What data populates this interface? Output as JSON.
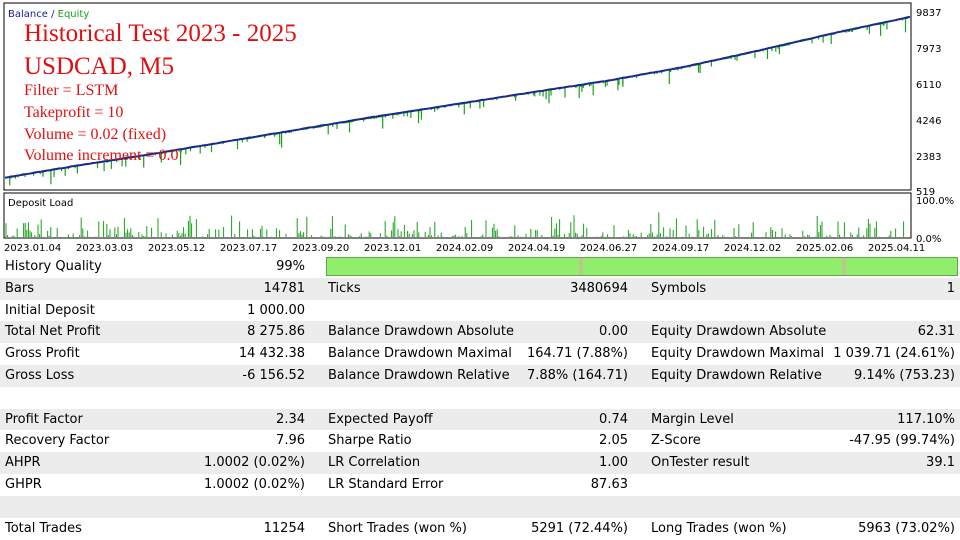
{
  "chart": {
    "legend_balance": "Balance",
    "legend_sep": " / ",
    "legend_equity": "Equity",
    "colors": {
      "balance": "#1a2a8c",
      "equity": "#1aa01a",
      "deposit_load": "#1aa01a",
      "legend_balance": "#1a1aa0",
      "legend_equity": "#1aa01a"
    },
    "overlay_title_1": "Historical Test 2023 - 2025",
    "overlay_title_2": "USDCAD, M5",
    "overlay_lines": [
      "Filter = LSTM",
      "Takeprofit = 10",
      "Volume = 0.02 (fixed)",
      "Volume increment = 0.0"
    ],
    "y_ticks": [
      "9837",
      "7973",
      "6110",
      "4246",
      "2383",
      "519"
    ],
    "deposit_load_label": "Deposit Load",
    "deposit_load_ticks": [
      "100.0%",
      "0.0%"
    ],
    "x_ticks": [
      "2023.01.04",
      "2023.03.03",
      "2023.05.12",
      "2023.07.17",
      "2023.09.20",
      "2023.12.01",
      "2024.02.09",
      "2024.04.19",
      "2024.06.27",
      "2024.09.17",
      "2024.12.02",
      "2025.02.06",
      "2025.04.11"
    ]
  },
  "chart_data": {
    "type": "line",
    "series": [
      {
        "name": "Balance",
        "x": [
          "2023.01.04",
          "2023.03.03",
          "2023.05.12",
          "2023.07.17",
          "2023.09.20",
          "2023.12.01",
          "2024.02.09",
          "2024.04.19",
          "2024.06.27",
          "2024.09.17",
          "2024.12.02",
          "2025.02.06",
          "2025.04.11"
        ],
        "values": [
          1000,
          1650,
          2250,
          2900,
          3550,
          4200,
          4800,
          5400,
          6000,
          6700,
          7550,
          8450,
          9276
        ]
      },
      {
        "name": "Equity",
        "x": [
          "2023.01.04",
          "2023.03.03",
          "2023.05.12",
          "2023.07.17",
          "2023.09.20",
          "2023.12.01",
          "2024.02.09",
          "2024.04.19",
          "2024.06.27",
          "2024.09.17",
          "2024.12.02",
          "2025.02.06",
          "2025.04.11"
        ],
        "values": [
          990,
          1630,
          2230,
          2880,
          3520,
          4170,
          4780,
          5380,
          5980,
          6680,
          7520,
          8420,
          9250
        ]
      }
    ],
    "ylim": [
      519,
      9837
    ],
    "grid": false
  },
  "report": {
    "history_quality_label": "History Quality",
    "history_quality_value": "99%",
    "bars_label": "Bars",
    "bars_value": "14781",
    "ticks_label": "Ticks",
    "ticks_value": "3480694",
    "symbols_label": "Symbols",
    "symbols_value": "1",
    "initial_deposit_label": "Initial Deposit",
    "initial_deposit_value": "1 000.00",
    "total_net_profit_label": "Total Net Profit",
    "total_net_profit_value": "8 275.86",
    "bal_dd_abs_label": "Balance Drawdown Absolute",
    "bal_dd_abs_value": "0.00",
    "eq_dd_abs_label": "Equity Drawdown Absolute",
    "eq_dd_abs_value": "62.31",
    "gross_profit_label": "Gross Profit",
    "gross_profit_value": "14 432.38",
    "bal_dd_max_label": "Balance Drawdown Maximal",
    "bal_dd_max_value": "164.71 (7.88%)",
    "eq_dd_max_label": "Equity Drawdown Maximal",
    "eq_dd_max_value": "1 039.71 (24.61%)",
    "gross_loss_label": "Gross Loss",
    "gross_loss_value": "-6 156.52",
    "bal_dd_rel_label": "Balance Drawdown Relative",
    "bal_dd_rel_value": "7.88% (164.71)",
    "eq_dd_rel_label": "Equity Drawdown Relative",
    "eq_dd_rel_value": "9.14% (753.23)",
    "profit_factor_label": "Profit Factor",
    "profit_factor_value": "2.34",
    "expected_payoff_label": "Expected Payoff",
    "expected_payoff_value": "0.74",
    "margin_level_label": "Margin Level",
    "margin_level_value": "117.10%",
    "recovery_factor_label": "Recovery Factor",
    "recovery_factor_value": "7.96",
    "sharpe_label": "Sharpe Ratio",
    "sharpe_value": "2.05",
    "zscore_label": "Z-Score",
    "zscore_value": "-47.95 (99.74%)",
    "ahpr_label": "AHPR",
    "ahpr_value": "1.0002 (0.02%)",
    "lr_corr_label": "LR Correlation",
    "lr_corr_value": "1.00",
    "ontester_label": "OnTester result",
    "ontester_value": "39.1",
    "ghpr_label": "GHPR",
    "ghpr_value": "1.0002 (0.02%)",
    "lr_stderr_label": "LR Standard Error",
    "lr_stderr_value": "87.63",
    "total_trades_label": "Total Trades",
    "total_trades_value": "11254",
    "short_trades_label": "Short Trades (won %)",
    "short_trades_value": "5291 (72.44%)",
    "long_trades_label": "Long Trades (won %)",
    "long_trades_value": "5963 (73.02%)"
  }
}
